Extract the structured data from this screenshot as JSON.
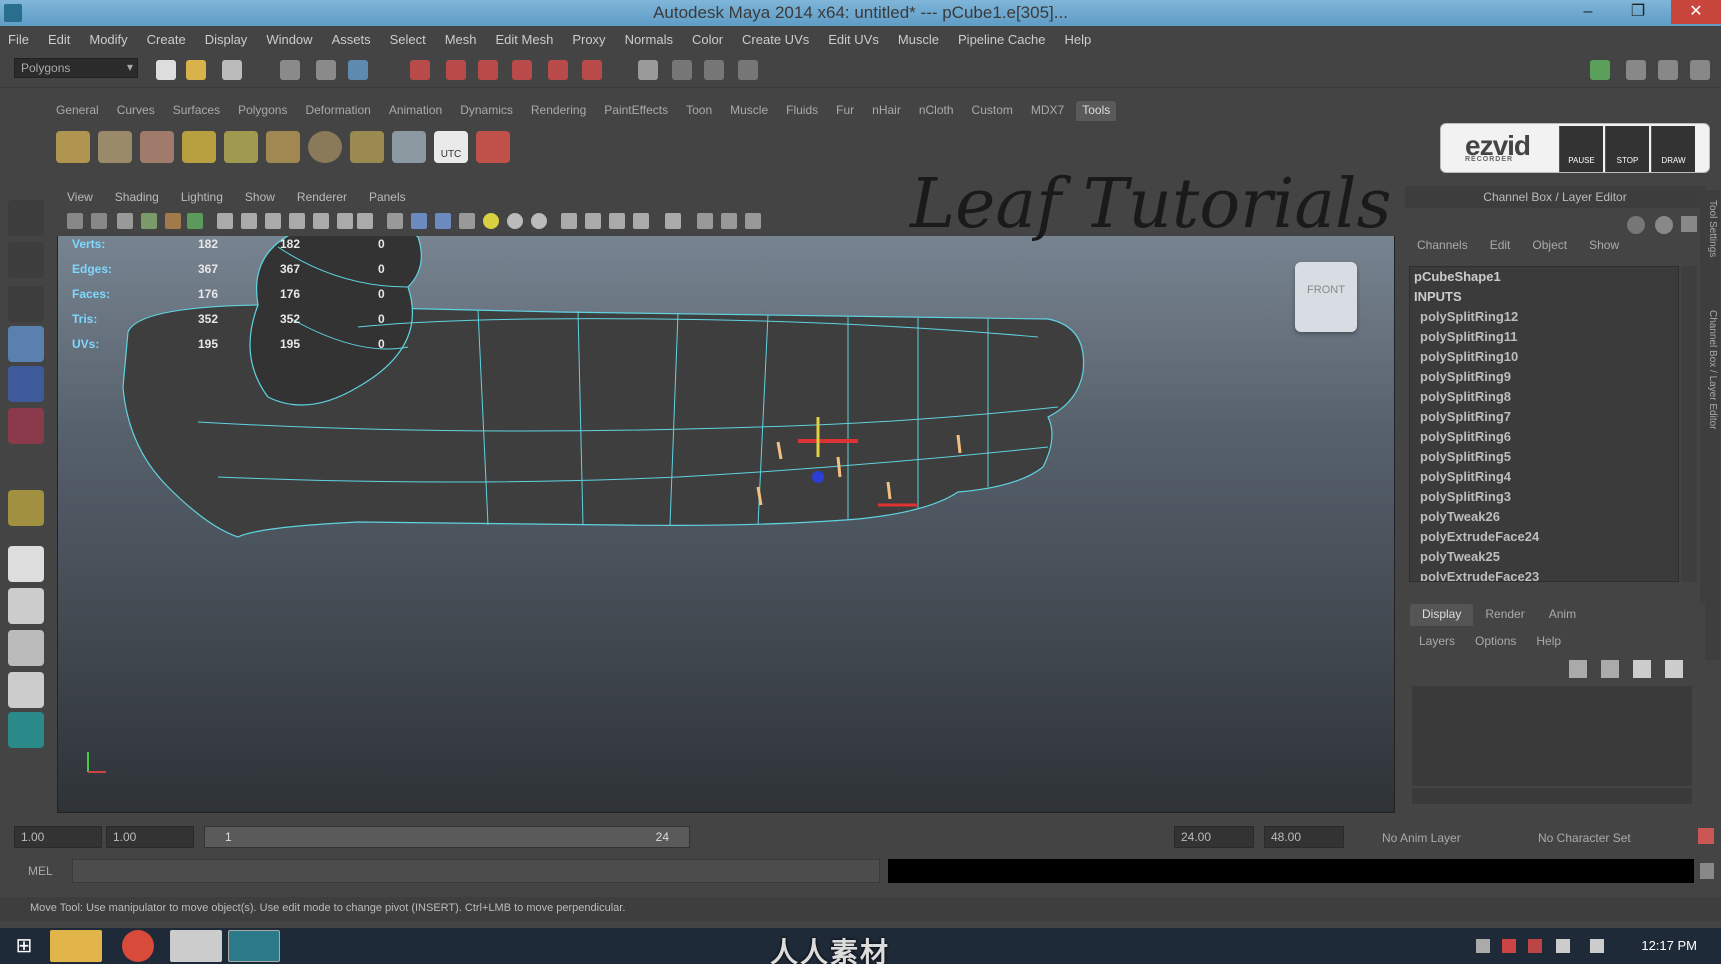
{
  "window": {
    "title": "Autodesk Maya 2014 x64: untitled*   ---   pCube1.e[305]...",
    "minimize": "–",
    "restore": "❐",
    "close": "✕"
  },
  "menubar": [
    "File",
    "Edit",
    "Modify",
    "Create",
    "Display",
    "Window",
    "Assets",
    "Select",
    "Mesh",
    "Edit Mesh",
    "Proxy",
    "Normals",
    "Color",
    "Create UVs",
    "Edit UVs",
    "Muscle",
    "Pipeline Cache",
    "Help"
  ],
  "statusline": {
    "menuset": "Polygons"
  },
  "shelf": {
    "tabs": [
      "General",
      "Curves",
      "Surfaces",
      "Polygons",
      "Deformation",
      "Animation",
      "Dynamics",
      "Rendering",
      "PaintEffects",
      "Toon",
      "Muscle",
      "Fluids",
      "Fur",
      "nHair",
      "nCloth",
      "Custom",
      "MDX7",
      "Tools"
    ],
    "active_tab": "Tools",
    "utc_label": "UTC"
  },
  "ezvid": {
    "logo": "ezvid",
    "tagline": "RECORDER",
    "pause": "PAUSE",
    "stop": "STOP",
    "draw": "DRAW"
  },
  "overlay_title": "Leaf Tutorials",
  "panel": {
    "menus": [
      "View",
      "Shading",
      "Lighting",
      "Show",
      "Renderer",
      "Panels"
    ],
    "viewcube": "FRONT"
  },
  "hud": {
    "rows": [
      {
        "label": "Verts:",
        "a": "182",
        "b": "182",
        "c": "0"
      },
      {
        "label": "Edges:",
        "a": "367",
        "b": "367",
        "c": "0"
      },
      {
        "label": "Faces:",
        "a": "176",
        "b": "176",
        "c": "0"
      },
      {
        "label": "Tris:",
        "a": "352",
        "b": "352",
        "c": "0"
      },
      {
        "label": "UVs:",
        "a": "195",
        "b": "195",
        "c": "0"
      }
    ]
  },
  "channel_box": {
    "title": "Channel Box / Layer Editor",
    "menus": [
      "Channels",
      "Edit",
      "Object",
      "Show"
    ],
    "shape": "pCubeShape1",
    "inputs_label": "INPUTS",
    "inputs": [
      "polySplitRing12",
      "polySplitRing11",
      "polySplitRing10",
      "polySplitRing9",
      "polySplitRing8",
      "polySplitRing7",
      "polySplitRing6",
      "polySplitRing5",
      "polySplitRing4",
      "polySplitRing3",
      "polyTweak26",
      "polyExtrudeFace24",
      "polyTweak25",
      "polyExtrudeFace23"
    ]
  },
  "side_tabs": [
    "Tool Settings",
    "Channel Box / Layer Editor"
  ],
  "layer_editor": {
    "tabs": [
      "Display",
      "Render",
      "Anim"
    ],
    "active_tab": "Display",
    "menus": [
      "Layers",
      "Options",
      "Help"
    ]
  },
  "range": {
    "start": "1.00",
    "playback_start": "1.00",
    "slider_start": "1",
    "slider_end": "24",
    "playback_end": "24.00",
    "end": "48.00",
    "anim_layer": "No Anim Layer",
    "character_set": "No Character Set"
  },
  "command_line": {
    "label": "MEL"
  },
  "help_line": "Move Tool: Use manipulator to move object(s). Use edit mode to change pivot (INSERT). Ctrl+LMB to move perpendicular.",
  "taskbar": {
    "clock": "12:17 PM",
    "brand": "人人素材"
  },
  "colors": {
    "wire": "#5fd3e0",
    "hud_label": "#7fd8ff",
    "accent_title": "#6aa6cf",
    "close_red": "#c9463d"
  }
}
